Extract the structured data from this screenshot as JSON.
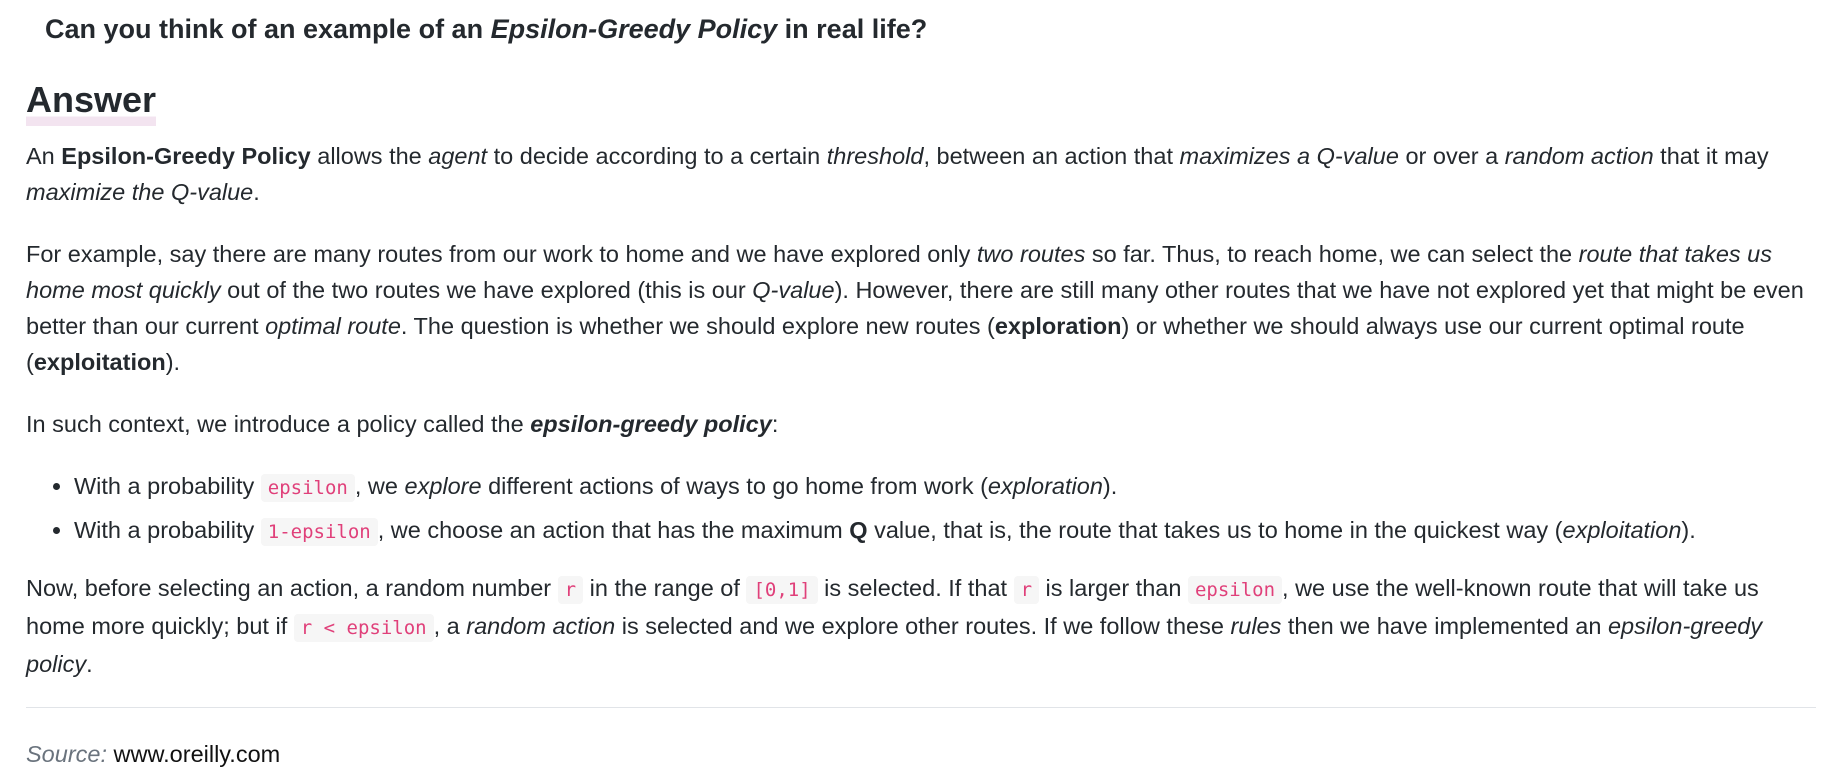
{
  "question": {
    "prefix": "Can you think of an example of an ",
    "emphasis": "Epsilon-Greedy Policy",
    "suffix": " in real life?"
  },
  "answer_heading": "Answer",
  "paragraph1": {
    "t1": "An ",
    "b1": "Epsilon-Greedy Policy",
    "t2": " allows the ",
    "i1": "agent",
    "t3": " to decide according to a certain ",
    "i2": "threshold",
    "t4": ", between an action that ",
    "i3": "maximizes a Q-value",
    "t5": " or over a ",
    "i4": "random action",
    "t6": " that it may ",
    "i5": "maximize the Q-value",
    "t7": "."
  },
  "paragraph2": {
    "t1": "For example, say there are many routes from our work to home and we have explored only ",
    "i1": "two routes",
    "t2": " so far. Thus, to reach home, we can select the ",
    "i2": "route that takes us home most quickly",
    "t3": " out of the two routes we have explored (this is our ",
    "i3": "Q-value",
    "t4": "). However, there are still many other routes that we have not explored yet that might be even better than our current ",
    "i4": "optimal route",
    "t5": ". The question is whether we should explore new routes (",
    "b1": "exploration",
    "t6": ") or whether we should always use our current optimal route (",
    "b2": "exploitation",
    "t7": ")."
  },
  "paragraph3": {
    "t1": "In such context, we introduce a policy called the ",
    "bi1": "epsilon-greedy policy",
    "t2": ":"
  },
  "bullets": [
    {
      "t1": "With a probability ",
      "c1": "epsilon",
      "t2": ", we ",
      "i1": "explore",
      "t3": " different actions of ways to go home from work (",
      "i2": "exploration",
      "t4": ")."
    },
    {
      "t1": "With a probability ",
      "c1": "1-epsilon",
      "t2": ", we choose an action that has the maximum ",
      "b1": "Q",
      "t3": " value, that is, the route that takes us to home in the quickest way (",
      "i1": "exploitation",
      "t4": ")."
    }
  ],
  "paragraph4": {
    "t1": "Now, before selecting an action, a random number ",
    "c1": "r",
    "t2": " in the range of ",
    "c2": "[0,1]",
    "t3": " is selected. If that ",
    "c3": "r",
    "t4": " is larger than ",
    "c4": "epsilon",
    "t5": ", we use the well-known route that will take us home more quickly; but if ",
    "c5": "r < epsilon",
    "t6": ", a ",
    "i1": "random action",
    "t7": " is selected and we explore other routes. If we follow these ",
    "i2": "rules",
    "t8": " then we have implemented an ",
    "i3": "epsilon-greedy policy",
    "t9": "."
  },
  "source": {
    "label": "Source:",
    "url": "www.oreilly.com"
  },
  "colors": {
    "text": "#24292e",
    "code_text": "#e0407a",
    "code_bg": "#f6f6f6",
    "divider": "#e1e4e8",
    "source_label": "#6a737d"
  }
}
